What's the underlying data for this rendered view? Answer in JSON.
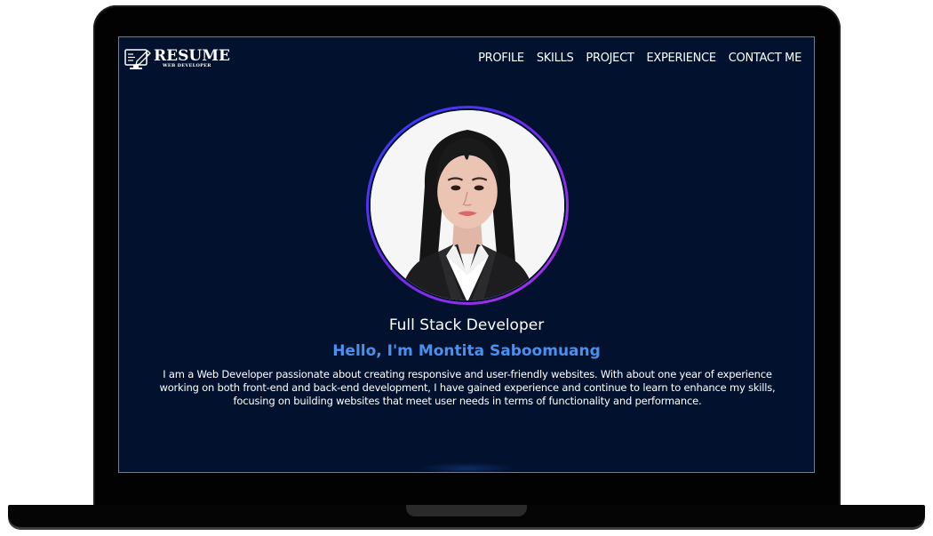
{
  "logo": {
    "title": "RESUME",
    "subtitle": "WEB DEVELOPER",
    "icon": "resume-monitor-pen-icon"
  },
  "nav": {
    "items": [
      {
        "label": "PROFILE"
      },
      {
        "label": "SKILLS"
      },
      {
        "label": "PROJECT"
      },
      {
        "label": "EXPERIENCE"
      },
      {
        "label": "CONTACT ME"
      }
    ]
  },
  "hero": {
    "role": "Full Stack Developer",
    "greeting": "Hello, I'm Montita Saboomuang",
    "bio": "I am a Web Developer passionate about creating responsive and user-friendly websites. With about one year of experience working on both front-end and back-end development, I have gained experience and continue to learn to enhance my skills, focusing on building websites that meet user needs in terms of functionality and performance."
  },
  "colors": {
    "background": "#01112e",
    "accent": "#4a90ef",
    "ring_start": "#2c3dff",
    "ring_end": "#b232e8"
  }
}
